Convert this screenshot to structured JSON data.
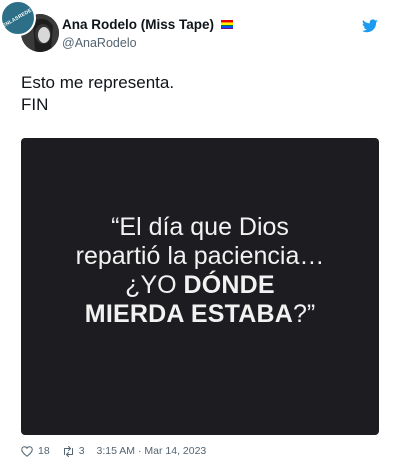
{
  "watermark": {
    "text": "VISTOENLASREDES.COM"
  },
  "author": {
    "display_name": "Ana Rodelo (Miss Tape)",
    "handle": "@AnaRodelo"
  },
  "tweet": {
    "text_line1": "Esto me representa.",
    "text_line2": "FIN"
  },
  "media": {
    "line1": "“El día que Dios",
    "line2": "repartió la paciencia…",
    "line3_normal": "¿YO ",
    "line3_bold": "DÓNDE",
    "line4_bold": "MIERDA ESTABA",
    "line4_end": "?”"
  },
  "footer": {
    "likes": "18",
    "retweets": "3",
    "timestamp": "3:15 AM · Mar 14, 2023"
  },
  "colors": {
    "twitter_blue": "#1d9bf0",
    "media_bg": "#1d1c20",
    "muted": "#536471"
  },
  "icons": [
    "avatar",
    "pride-flag-icon",
    "twitter-bird-icon",
    "heart-icon",
    "retweet-icon"
  ]
}
